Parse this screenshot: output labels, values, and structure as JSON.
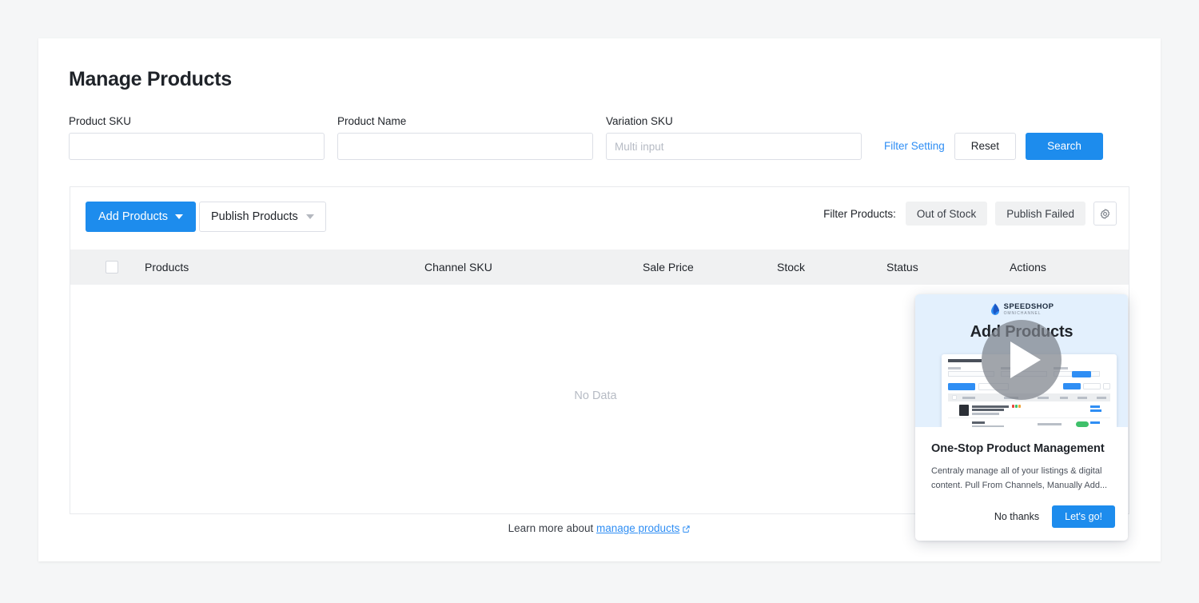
{
  "page": {
    "title": "Manage Products"
  },
  "filters": {
    "product_sku": {
      "label": "Product SKU",
      "value": "",
      "placeholder": ""
    },
    "product_name": {
      "label": "Product Name",
      "value": "",
      "placeholder": ""
    },
    "variation_sku": {
      "label": "Variation SKU",
      "value": "",
      "placeholder": "Multi input"
    },
    "filter_setting_label": "Filter Setting",
    "reset_label": "Reset",
    "search_label": "Search"
  },
  "toolbar": {
    "add_products_label": "Add Products",
    "publish_products_label": "Publish Products",
    "filter_products_label": "Filter Products:",
    "chips": [
      "Out of Stock",
      "Publish Failed"
    ],
    "settings_icon": "gear-icon"
  },
  "table": {
    "columns": [
      "Products",
      "Channel SKU",
      "Sale Price",
      "Stock",
      "Status",
      "Actions"
    ],
    "select_all_checked": false,
    "empty_text": "No Data"
  },
  "footer": {
    "learn_more_prefix": "Learn more about",
    "learn_more_link": "manage products",
    "external_icon": "external-link-icon"
  },
  "promo": {
    "logo_name": "SPEEDSHOP",
    "logo_sub": "OMNICHANNEL",
    "logo_icon": "water-drop-logo-icon",
    "title": "Add Products",
    "play_icon": "play-button-icon",
    "heading": "One-Stop Product Management",
    "description": "Centraly manage all of your listings & digital content. Pull From Channels, Manually Add...",
    "dismiss_label": "No thanks",
    "cta_label": "Let's go!"
  },
  "colors": {
    "accent_blue": "#1d8ced",
    "link_blue": "#2f8ef4",
    "promo_header_bg": "#e3f0fd",
    "table_header_bg": "#f0f1f2",
    "page_bg": "#f5f6f7"
  }
}
